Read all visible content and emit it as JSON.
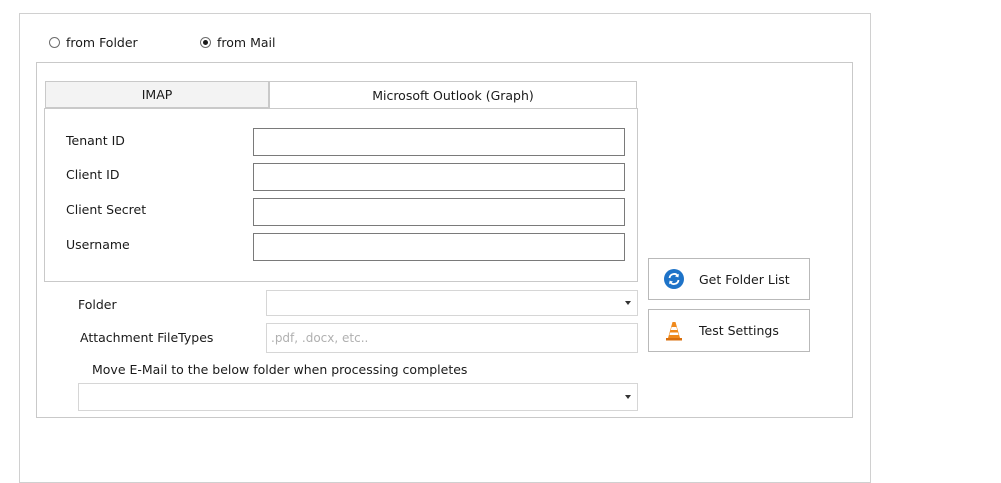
{
  "source": {
    "options": [
      {
        "label": "from Folder",
        "checked": false
      },
      {
        "label": "from Mail",
        "checked": true
      }
    ]
  },
  "tabs": [
    {
      "label": "IMAP",
      "active": false
    },
    {
      "label": "Microsoft Outlook (Graph)",
      "active": true
    }
  ],
  "graph": {
    "tenant_id": {
      "label": "Tenant ID",
      "value": ""
    },
    "client_id": {
      "label": "Client ID",
      "value": ""
    },
    "client_secret": {
      "label": "Client Secret",
      "value": ""
    },
    "username": {
      "label": "Username",
      "value": ""
    }
  },
  "folder": {
    "label": "Folder",
    "selected": ""
  },
  "attachments": {
    "label": "Attachment FileTypes",
    "placeholder": ".pdf, .docx, etc..",
    "value": ""
  },
  "move": {
    "label": "Move E-Mail to the below folder when processing completes",
    "selected": ""
  },
  "buttons": {
    "get_folder_list": {
      "label": "Get Folder List",
      "icon": "refresh-icon"
    },
    "test_settings": {
      "label": "Test Settings",
      "icon": "traffic-cone-icon"
    }
  },
  "colors": {
    "refresh_icon": "#1e73c8",
    "cone_orange": "#f08a1c"
  }
}
